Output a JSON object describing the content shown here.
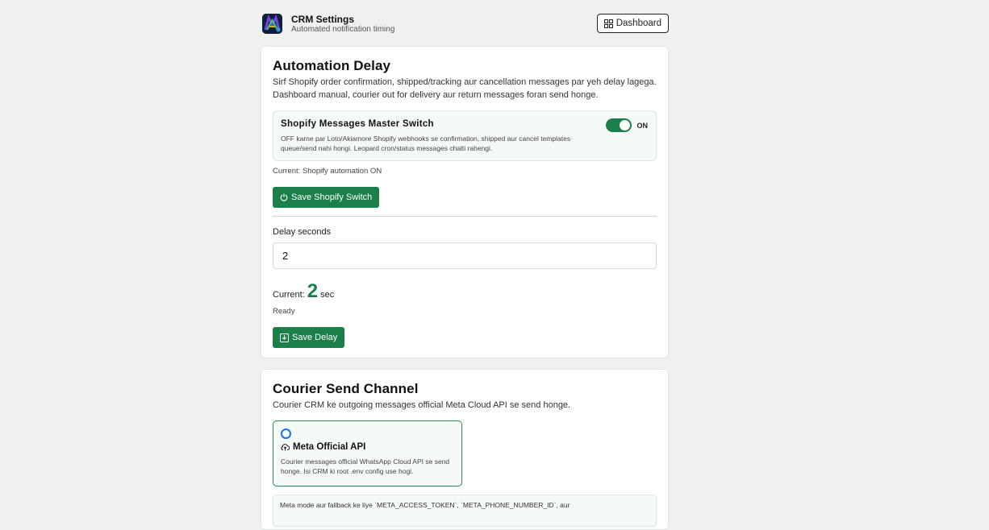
{
  "header": {
    "title": "CRM Settings",
    "subtitle": "Automated notification timing",
    "dashboard_label": "Dashboard"
  },
  "automation": {
    "title": "Automation Delay",
    "desc_line1": "Sirf Shopify order confirmation, shipped/tracking aur cancellation messages par yeh delay lagega.",
    "desc_line2": "Dashboard manual, courier out for delivery aur return messages foran send honge.",
    "master_switch": {
      "title": "Shopify Messages Master Switch",
      "desc_line1": "OFF karne par Loto/Akiamore Shopify webhooks se confirmation, shipped aur cancel templates",
      "desc_line2": "queue/send nahi hongi. Leopard cron/status messages chalti rahengi.",
      "state_label": "ON",
      "enabled": true
    },
    "current_status": "Current: Shopify automation ON",
    "save_switch_label": "Save Shopify Switch",
    "delay_label": "Delay seconds",
    "delay_value": "2",
    "current_prefix": "Current:",
    "current_value": "2",
    "current_unit": "sec",
    "ready_text": "Ready",
    "save_delay_label": "Save Delay"
  },
  "courier": {
    "title": "Courier Send Channel",
    "desc": "Courier CRM ke outgoing messages official Meta Cloud API se send honge.",
    "option": {
      "title": "Meta Official API",
      "desc_line1": "Courier messages official WhatsApp Cloud API se send",
      "desc_line2": "honge. Isi CRM ki root .env config use hogi.",
      "selected": true
    },
    "note": "Meta mode aur fallback ke liye `META_ACCESS_TOKEN`, `META_PHONE_NUMBER_ID`, aur"
  },
  "colors": {
    "accent": "#1b7f4a",
    "radio": "#1a73e8",
    "background": "#eef1ee"
  }
}
